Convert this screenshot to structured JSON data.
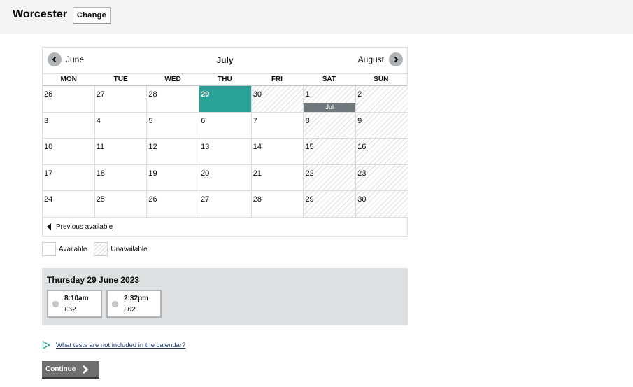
{
  "header": {
    "centre": "Worcester",
    "change_label": "Change"
  },
  "calendar": {
    "month": "July",
    "prev_month": "June",
    "next_month": "August",
    "days_of_week": [
      "MON",
      "TUE",
      "WED",
      "THU",
      "FRI",
      "SAT",
      "SUN"
    ],
    "weeks": [
      [
        {
          "day": "26",
          "status": "available"
        },
        {
          "day": "27",
          "status": "available"
        },
        {
          "day": "28",
          "status": "available"
        },
        {
          "day": "29",
          "status": "selected"
        },
        {
          "day": "30",
          "status": "unavailable"
        },
        {
          "day": "1",
          "status": "unavailable",
          "month_tag": "Jul"
        },
        {
          "day": "2",
          "status": "unavailable"
        }
      ],
      [
        {
          "day": "3",
          "status": "available"
        },
        {
          "day": "4",
          "status": "available"
        },
        {
          "day": "5",
          "status": "available"
        },
        {
          "day": "6",
          "status": "available"
        },
        {
          "day": "7",
          "status": "available"
        },
        {
          "day": "8",
          "status": "unavailable"
        },
        {
          "day": "9",
          "status": "unavailable"
        }
      ],
      [
        {
          "day": "10",
          "status": "available"
        },
        {
          "day": "11",
          "status": "available"
        },
        {
          "day": "12",
          "status": "available"
        },
        {
          "day": "13",
          "status": "available"
        },
        {
          "day": "14",
          "status": "available"
        },
        {
          "day": "15",
          "status": "unavailable"
        },
        {
          "day": "16",
          "status": "unavailable"
        }
      ],
      [
        {
          "day": "17",
          "status": "available"
        },
        {
          "day": "18",
          "status": "available"
        },
        {
          "day": "19",
          "status": "available"
        },
        {
          "day": "20",
          "status": "available"
        },
        {
          "day": "21",
          "status": "available"
        },
        {
          "day": "22",
          "status": "unavailable"
        },
        {
          "day": "23",
          "status": "unavailable"
        }
      ],
      [
        {
          "day": "24",
          "status": "available"
        },
        {
          "day": "25",
          "status": "available"
        },
        {
          "day": "26",
          "status": "available"
        },
        {
          "day": "27",
          "status": "available"
        },
        {
          "day": "28",
          "status": "available"
        },
        {
          "day": "29",
          "status": "unavailable"
        },
        {
          "day": "30",
          "status": "unavailable"
        }
      ]
    ],
    "previous_available": "Previous available"
  },
  "legend": {
    "available": "Available",
    "unavailable": "Unavailable"
  },
  "slots": {
    "date": "Thursday 29 June 2023",
    "items": [
      {
        "time": "8:10am",
        "price": "£62"
      },
      {
        "time": "2:32pm",
        "price": "£62"
      }
    ]
  },
  "help_link": "What tests are not included in the calendar?",
  "continue_label": "Continue",
  "colors": {
    "selected": "#28a197",
    "month_tag": "#6f777b",
    "button": "#6f6f6f",
    "slot_panel": "#dee0e2"
  },
  "icons": [
    "chevron-left-icon",
    "chevron-right-icon",
    "play-outline-icon",
    "chevron-right-bold-icon"
  ]
}
